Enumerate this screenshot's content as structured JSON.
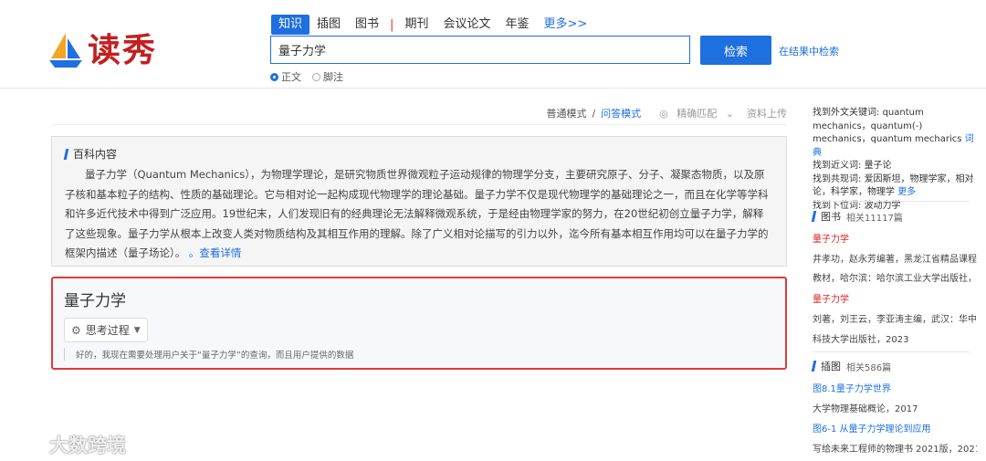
{
  "logo": {
    "text": "读秀"
  },
  "tabs": [
    {
      "label": "知识",
      "active": true
    },
    {
      "label": "插图"
    },
    {
      "label": "图书"
    },
    {
      "label": "期刊"
    },
    {
      "label": "会议论文"
    },
    {
      "label": "年鉴"
    },
    {
      "label": "更多>>"
    }
  ],
  "search": {
    "value": "量子力学",
    "button": "检索",
    "within": "在结果中检索"
  },
  "scope": {
    "options": [
      "正文",
      "脚注"
    ],
    "selected": "正文"
  },
  "toolbar": {
    "mode_normal": "普通模式",
    "divider": "/",
    "mode_qa": "问答模式",
    "match": "精确匹配",
    "upload": "资料上传"
  },
  "baike": {
    "title": "百科内容",
    "text": "量子力学（Quantum Mechanics），为物理学理论，是研究物质世界微观粒子运动规律的物理学分支，主要研究原子、分子、凝聚态物质，以及原子核和基本粒子的结构、性质的基础理论。它与相对论一起构成现代物理学的理论基础。量子力学不仅是现代物理学的基础理论之一，而且在化学等学科和许多近代技术中得到广泛应用。19世纪末，人们发现旧有的经典理论无法解释微观系统，于是经由物理学家的努力，在20世纪初创立量子力学，解释了这些现象。量子力学从根本上改变人类对物质结构及其相互作用的理解。除了广义相对论描写的引力以外，迄今所有基本相互作用均可以在量子力学的框架内描述（量子场论）。",
    "more": "查看详情"
  },
  "answer": {
    "title": "量子力学",
    "think_label": "思考过程",
    "note": "好的，我现在需要处理用户关于“量子力学”的查询，而且用户提供的数据"
  },
  "side": {
    "foreign_label": "找到外文关键词:",
    "foreign_value": "quantum mechanics，quantum(-) mechanics，quantum mecharics",
    "dict": "词典",
    "near_label": "找到近义词:",
    "near_value": "量子论",
    "co_label": "找到共现词:",
    "co_value": "爱因斯坦，物理学家，相对论，科学家，物理学",
    "co_more": "更多",
    "lower_label": "找到下位词:",
    "lower_value": "波动力学",
    "books": {
      "title": "图书",
      "count": "相关11117篇",
      "items": [
        {
          "title": "量子力学",
          "meta1": "井孝功，赵永芳编著，黑龙江省精品课程",
          "meta2": "教材，哈尔滨：哈尔滨工业大学出版社，"
        },
        {
          "title": "量子力学",
          "meta1": "刘著，刘王云，李亚涛主编，武汉：华中",
          "meta2": "科技大学出版社，2023"
        }
      ]
    },
    "figures": {
      "title": "插图",
      "count": "相关586篇",
      "items": [
        {
          "title": "图8.1量子力学世界",
          "meta": "大学物理基础概论，2017"
        },
        {
          "title": "图6-1 从量子力学理论到应用",
          "meta": "写给未来工程师的物理书 2021版，2021"
        }
      ]
    }
  },
  "watermark": {
    "text": "大数跨境"
  }
}
